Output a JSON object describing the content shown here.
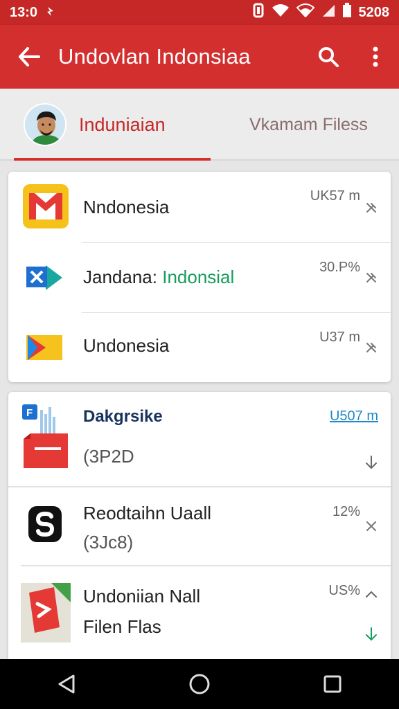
{
  "status": {
    "time": "13:0",
    "battery": "5208"
  },
  "app_bar": {
    "title": "Undovlan Indonsiaa"
  },
  "tabs": {
    "primary": "Induniaian",
    "secondary": "Vkamam Filess"
  },
  "card1": {
    "rows": [
      {
        "name": "Nndonesia",
        "meta": "UK57 m"
      },
      {
        "name_prefix": "Jandana:",
        "name_highlight": "Indonsial",
        "meta": "30.P%"
      },
      {
        "name": "Undonesia",
        "meta": "U37 m"
      }
    ]
  },
  "card2": {
    "rows": [
      {
        "name": "Dakgrsike",
        "sub": "(3P2D",
        "meta": "U507 m",
        "badge": "F"
      },
      {
        "name": "Reodtaihn Uaall",
        "sub": "(3Jc8)",
        "meta": "12%"
      },
      {
        "name": "Undoniian Nall",
        "sub": "Filen Flas",
        "meta": "US%"
      }
    ]
  },
  "colors": {
    "primary": "#d32f2f",
    "status": "#c62828",
    "accent_green": "#169c5c",
    "link_blue": "#1e88c8"
  }
}
